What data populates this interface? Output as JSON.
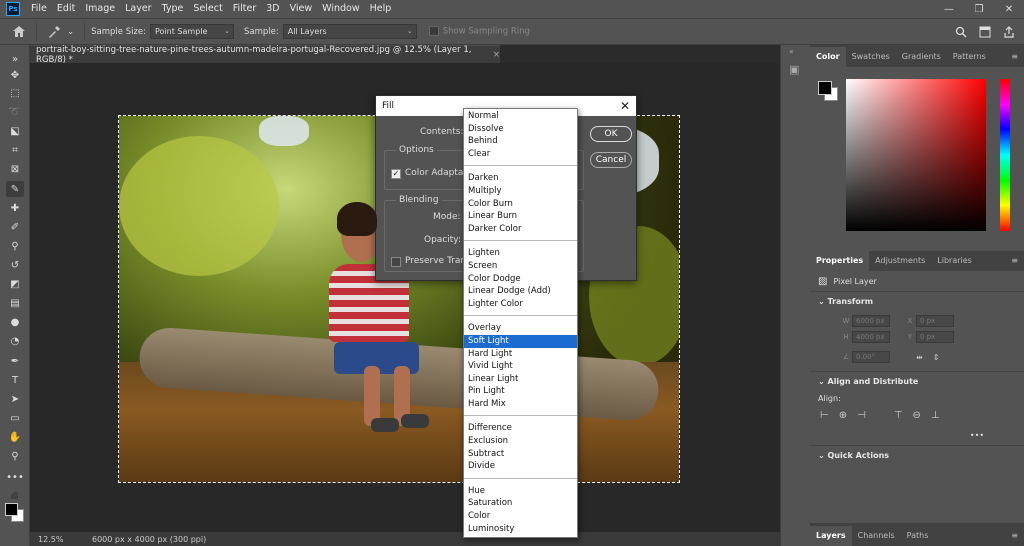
{
  "app": {
    "logo": "Ps",
    "menus": [
      "File",
      "Edit",
      "Image",
      "Layer",
      "Type",
      "Select",
      "Filter",
      "3D",
      "View",
      "Window",
      "Help"
    ],
    "window_controls": [
      "—",
      "❐",
      "✕"
    ]
  },
  "options_bar": {
    "sample_size_label": "Sample Size:",
    "sample_size_value": "Point Sample",
    "sample_label": "Sample:",
    "sample_value": "All Layers",
    "show_ring_label": "Show Sampling Ring"
  },
  "document": {
    "tab_title": "portrait-boy-sitting-tree-nature-pine-trees-autumn-madeira-portugal-Recovered.jpg @ 12.5% (Layer 1, RGB/8) *",
    "tab_close": "×",
    "zoom": "12.5%",
    "info": "6000 px x 4000 px (300 ppi)"
  },
  "color_panel": {
    "tabs": [
      "Color",
      "Swatches",
      "Gradients",
      "Patterns"
    ],
    "active_tab": "Color",
    "hue_color": "#ff0000"
  },
  "properties_panel": {
    "tabs": [
      "Properties",
      "Adjustments",
      "Libraries"
    ],
    "layer_type": "Pixel Layer",
    "transform_title": "Transform",
    "w_label": "W",
    "w_value": "6000 px",
    "x_label": "X",
    "x_value": "0 px",
    "h_label": "H",
    "h_value": "4000 px",
    "y_label": "Y",
    "y_value": "0 px",
    "angle_value": "0.00°",
    "align_title": "Align and Distribute",
    "align_label": "Align:",
    "more": "•••",
    "quick_actions_title": "Quick Actions"
  },
  "bottom_panel": {
    "tabs": [
      "Layers",
      "Channels",
      "Paths"
    ],
    "active_tab": "Layers"
  },
  "fill_dialog": {
    "title": "Fill",
    "contents_label": "Contents:",
    "options_title": "Options",
    "color_adaptation_label": "Color Adaptation",
    "blending_title": "Blending",
    "mode_label": "Mode:",
    "opacity_label": "Opacity:",
    "preserve_label": "Preserve Trans",
    "ok_label": "OK",
    "cancel_label": "Cancel"
  },
  "blend_modes": {
    "groups": [
      [
        "Normal",
        "Dissolve",
        "Behind",
        "Clear"
      ],
      [
        "Darken",
        "Multiply",
        "Color Burn",
        "Linear Burn",
        "Darker Color"
      ],
      [
        "Lighten",
        "Screen",
        "Color Dodge",
        "Linear Dodge (Add)",
        "Lighter Color"
      ],
      [
        "Overlay",
        "Soft Light",
        "Hard Light",
        "Vivid Light",
        "Linear Light",
        "Pin Light",
        "Hard Mix"
      ],
      [
        "Difference",
        "Exclusion",
        "Subtract",
        "Divide"
      ],
      [
        "Hue",
        "Saturation",
        "Color",
        "Luminosity"
      ]
    ],
    "selected": "Soft Light"
  }
}
